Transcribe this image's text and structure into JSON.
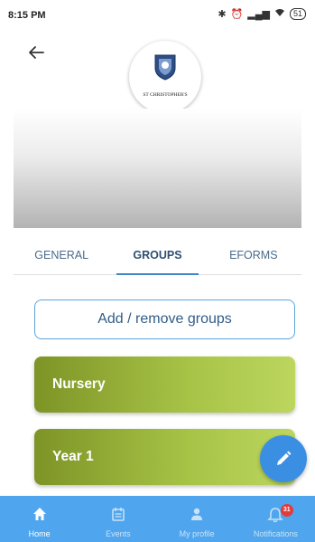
{
  "status_bar": {
    "time": "8:15 PM",
    "battery": "51"
  },
  "header": {
    "school_logo_text": "ST CHRISTOPHER'S"
  },
  "tabs": [
    {
      "label": "GENERAL",
      "active": false
    },
    {
      "label": "GROUPS",
      "active": true
    },
    {
      "label": "EFORMS",
      "active": false
    }
  ],
  "add_button": {
    "label": "Add / remove groups"
  },
  "groups": [
    {
      "label": "Nursery"
    },
    {
      "label": "Year 1"
    }
  ],
  "bottom_nav": [
    {
      "label": "Home",
      "icon": "home-icon",
      "active": true
    },
    {
      "label": "Events",
      "icon": "calendar-icon",
      "active": false
    },
    {
      "label": "My profile",
      "icon": "person-icon",
      "active": false
    },
    {
      "label": "Notifications",
      "icon": "bell-icon",
      "active": false,
      "badge": "31"
    }
  ],
  "colors": {
    "accent": "#3a8fe3",
    "nav_bar": "#4fa6ee",
    "group_card": "#9bb53a",
    "badge": "#e23b3b"
  }
}
